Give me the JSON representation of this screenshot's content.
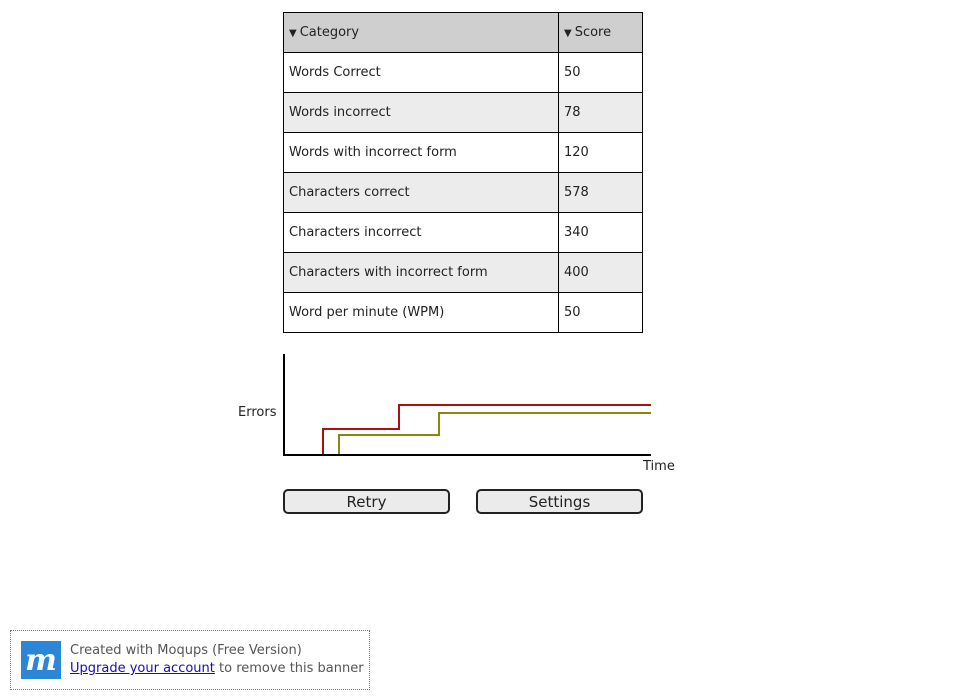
{
  "table": {
    "headers": {
      "category": "Category",
      "score": "Score"
    },
    "rows": [
      {
        "category": "Words Correct",
        "score": "50"
      },
      {
        "category": "Words incorrect",
        "score": "78"
      },
      {
        "category": "Words with incorrect form",
        "score": "120"
      },
      {
        "category": "Characters correct",
        "score": "578"
      },
      {
        "category": "Characters incorrect",
        "score": "340"
      },
      {
        "category": "Characters with incorrect form",
        "score": "400"
      },
      {
        "category": "Word per minute (WPM)",
        "score": "50"
      }
    ]
  },
  "chart": {
    "ylabel": "Errors",
    "xlabel": "Time",
    "colors": {
      "series_a": "#aa1111",
      "series_b": "#888811"
    }
  },
  "buttons": {
    "retry": "Retry",
    "settings": "Settings"
  },
  "banner": {
    "line1": "Created with Moqups (Free Version)",
    "link": "Upgrade your account",
    "line2_suffix": " to remove this banner",
    "logo_letter": "m"
  }
}
